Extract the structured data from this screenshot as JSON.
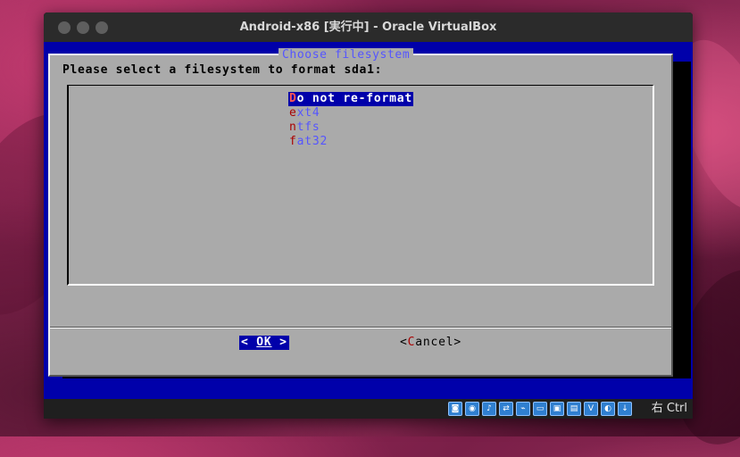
{
  "window": {
    "title": "Android-x86 [実行中] - Oracle VirtualBox"
  },
  "dialog": {
    "title": "Choose filesystem",
    "prompt": "Please select a filesystem to format sda1:",
    "options": [
      {
        "hotkey": "D",
        "rest": "o not re-format",
        "selected": true
      },
      {
        "hotkey": "e",
        "rest": "xt4",
        "selected": false
      },
      {
        "hotkey": "n",
        "rest": "tfs",
        "selected": false
      },
      {
        "hotkey": "f",
        "rest": "at32",
        "selected": false
      }
    ],
    "ok_button": {
      "left": "<  ",
      "hotkey": "OK",
      "right": "  >"
    },
    "cancel_button": {
      "left": "<",
      "hotkey": "C",
      "right": "ancel>"
    }
  },
  "statusbar": {
    "host_key": "右 Ctrl",
    "icons": [
      {
        "name": "hard-disk-icon",
        "glyph": "◙"
      },
      {
        "name": "optical-drive-icon",
        "glyph": "◉"
      },
      {
        "name": "audio-icon",
        "glyph": "♪"
      },
      {
        "name": "network-icon",
        "glyph": "⇄"
      },
      {
        "name": "usb-icon",
        "glyph": "⌁"
      },
      {
        "name": "shared-folders-icon",
        "glyph": "▭"
      },
      {
        "name": "display-icon",
        "glyph": "▣"
      },
      {
        "name": "video-capture-icon",
        "glyph": "▤"
      },
      {
        "name": "virtualization-icon",
        "glyph": "V"
      },
      {
        "name": "guest-additions-icon",
        "glyph": "◐"
      },
      {
        "name": "mouse-integration-icon",
        "glyph": "↓"
      }
    ]
  },
  "colors": {
    "screen_blue": "#0000aa",
    "dialog_gray": "#aaaaaa",
    "hotkey_red": "#aa0000",
    "item_blue": "#5555ff"
  }
}
